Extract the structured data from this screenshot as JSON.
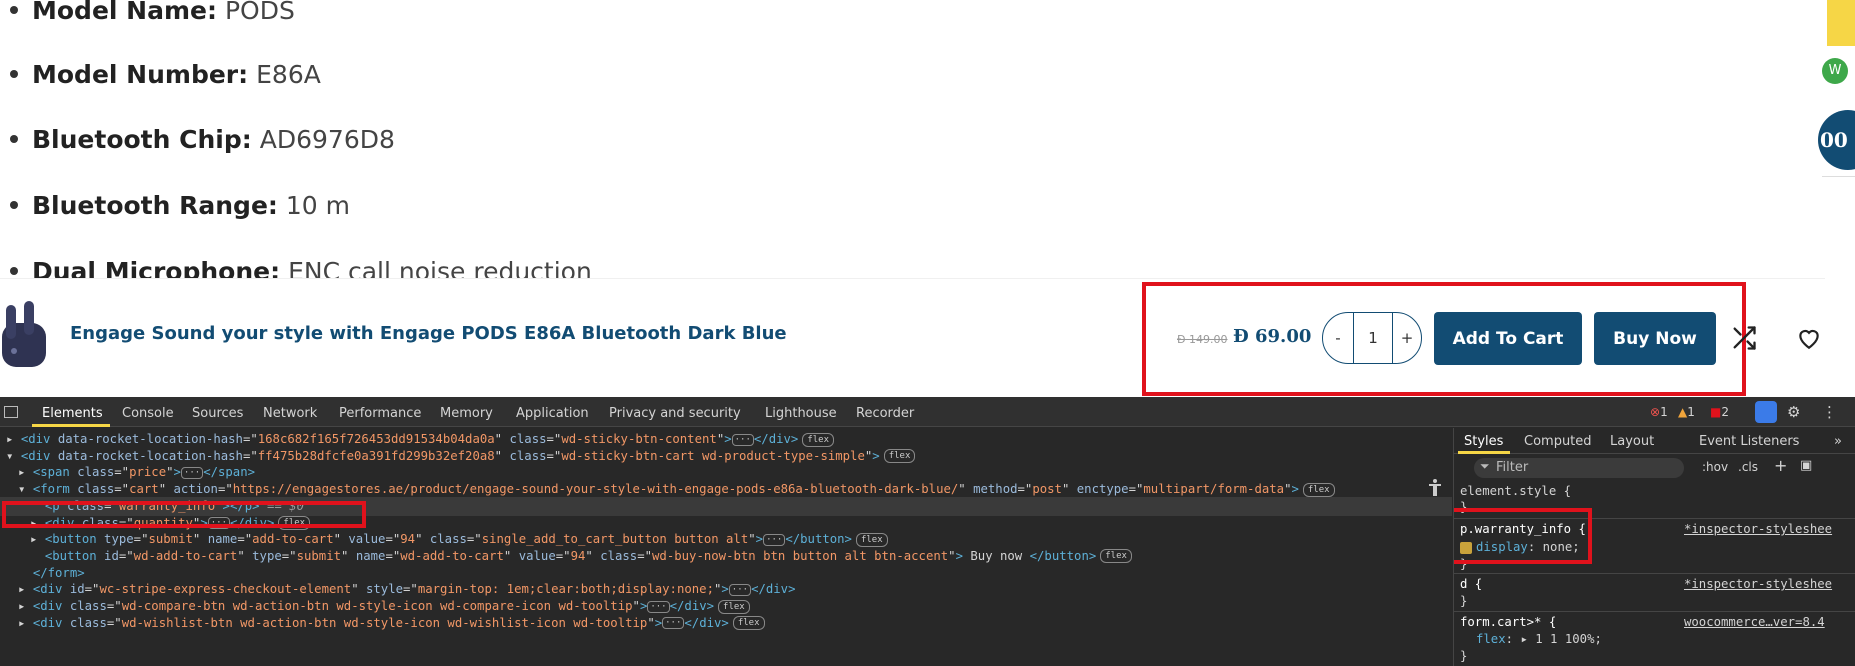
{
  "specs": [
    {
      "label": "Model Name:",
      "value": "PODS"
    },
    {
      "label": "Model Number:",
      "value": "E86A"
    },
    {
      "label": "Bluetooth Chip:",
      "value": "AD6976D8"
    },
    {
      "label": "Bluetooth Range:",
      "value": "10 m"
    },
    {
      "label": "Dual Microphone:",
      "value": "ENC call noise reduction"
    }
  ],
  "edge": {
    "w_badge": "W",
    "circle_text": "00"
  },
  "sticky": {
    "title": "Engage Sound your style with Engage PODS E86A Bluetooth Dark Blue",
    "old_price": "149.00",
    "new_price": "69.00",
    "qty_minus": "-",
    "qty_value": "1",
    "qty_plus": "+",
    "add_to_cart": "Add To Cart",
    "buy_now": "Buy Now"
  },
  "devtools": {
    "tabs": [
      "Elements",
      "Console",
      "Sources",
      "Network",
      "Performance",
      "Memory",
      "Application",
      "Privacy and security",
      "Lighthouse",
      "Recorder"
    ],
    "errors": "1",
    "warnings": "1",
    "issues": "2",
    "styles_tabs": [
      "Styles",
      "Computed",
      "Layout",
      "Event Listeners"
    ],
    "filter_placeholder": "Filter",
    "hov": ":hov",
    "cls": ".cls",
    "dom_lines": [
      {
        "indent": 1,
        "arrow": "▸",
        "tag_open": "<div ",
        "attrs": [
          [
            "data-rocket-location-hash",
            "168c682f165f726453dd91534b04da0a"
          ],
          [
            "class",
            "wd-sticky-btn-content"
          ]
        ],
        "tail": ">",
        "dots": true,
        "close": "</div>",
        "badge": "flex"
      },
      {
        "indent": 1,
        "arrow": "▾",
        "tag_open": "<div ",
        "attrs": [
          [
            "data-rocket-location-hash",
            "ff475b28dfcfe0a391fd299b32ef20a8"
          ],
          [
            "class",
            "wd-sticky-btn-cart wd-product-type-simple"
          ]
        ],
        "tail": ">",
        "dots": false,
        "close": "",
        "badge": "flex"
      },
      {
        "indent": 2,
        "arrow": "▸",
        "tag_open": "<span ",
        "attrs": [
          [
            "class",
            "price"
          ]
        ],
        "tail": ">",
        "dots": true,
        "close": "</span>",
        "badge": ""
      },
      {
        "indent": 2,
        "arrow": "▾",
        "tag_open": "<form ",
        "attrs": [
          [
            "class",
            "cart"
          ],
          [
            "action",
            "https://engagestores.ae/product/engage-sound-your-style-with-engage-pods-e86a-bluetooth-dark-blue/"
          ],
          [
            "method",
            "post"
          ],
          [
            "enctype",
            "multipart/form-data"
          ]
        ],
        "tail": ">",
        "dots": false,
        "close": "",
        "badge": "flex"
      },
      {
        "indent": 3,
        "arrow": "",
        "tag_open": "<p ",
        "attrs": [
          [
            "class",
            "warranty_info"
          ]
        ],
        "tail": ">",
        "dots": false,
        "close": "</p>",
        "badge": "",
        "eq": " == $0"
      },
      {
        "indent": 3,
        "arrow": "▸",
        "tag_open": "<div ",
        "attrs": [
          [
            "class",
            "quantity"
          ]
        ],
        "tail": ">",
        "dots": true,
        "close": "</div>",
        "badge": "flex"
      },
      {
        "indent": 3,
        "arrow": "▸",
        "tag_open": "<button ",
        "attrs": [
          [
            "type",
            "submit"
          ],
          [
            "name",
            "add-to-cart"
          ],
          [
            "value",
            "94"
          ],
          [
            "class",
            "single_add_to_cart_button button alt"
          ]
        ],
        "tail": ">",
        "dots": true,
        "close": "</button>",
        "badge": "flex"
      },
      {
        "indent": 3,
        "arrow": "",
        "tag_open": "<button ",
        "attrs": [
          [
            "id",
            "wd-add-to-cart"
          ],
          [
            "type",
            "submit"
          ],
          [
            "name",
            "wd-add-to-cart"
          ],
          [
            "value",
            "94"
          ],
          [
            "class",
            "wd-buy-now-btn btn button alt btn-accent"
          ]
        ],
        "tail": ">",
        "dots": false,
        "text": " Buy now ",
        "close": "</button>",
        "badge": "flex"
      },
      {
        "indent": 2,
        "arrow": "",
        "tag_open": "</form>",
        "attrs": [],
        "tail": "",
        "dots": false,
        "close": "",
        "badge": ""
      },
      {
        "indent": 2,
        "arrow": "▸",
        "tag_open": "<div ",
        "attrs": [
          [
            "id",
            "wc-stripe-express-checkout-element"
          ],
          [
            "style",
            "margin-top: 1em;clear:both;display:none;"
          ]
        ],
        "tail": ">",
        "dots": true,
        "close": "</div>",
        "badge": ""
      },
      {
        "indent": 2,
        "arrow": "▸",
        "tag_open": "<div ",
        "attrs": [
          [
            "class",
            "wd-compare-btn wd-action-btn wd-style-icon wd-compare-icon wd-tooltip"
          ]
        ],
        "tail": ">",
        "dots": true,
        "close": "</div>",
        "badge": "flex"
      },
      {
        "indent": 2,
        "arrow": "▸",
        "tag_open": "<div ",
        "attrs": [
          [
            "class",
            "wd-wishlist-btn wd-action-btn wd-style-icon wd-wishlist-icon wd-tooltip"
          ]
        ],
        "tail": ">",
        "dots": true,
        "close": "</div>",
        "badge": "flex"
      }
    ],
    "styles": {
      "element_style": "element.style {",
      "close_brace": "}",
      "rule1_selector": "p.warranty_info {",
      "rule1_prop": "display",
      "rule1_value": "none;",
      "rule1_src": "*inspector-styleshee",
      "rule2_selector": "d {",
      "rule2_src": "*inspector-styleshee",
      "rule3_selector": "form.cart>* {",
      "rule3_prop": "flex",
      "rule3_value": "▸ 1 1 100%;",
      "rule3_src": "woocommerce…ver=8.4"
    }
  }
}
